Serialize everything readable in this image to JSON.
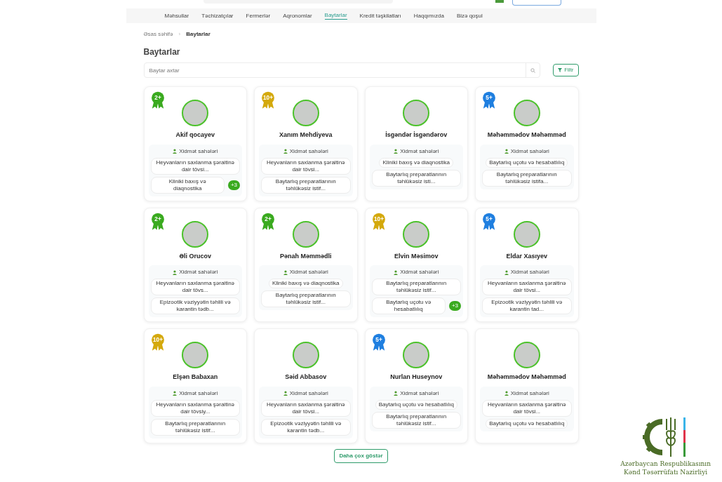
{
  "nav": [
    {
      "label": "Məhsullar",
      "selected": false
    },
    {
      "label": "Təchizatçılar",
      "selected": false
    },
    {
      "label": "Fermerlər",
      "selected": false
    },
    {
      "label": "Aqronomlar",
      "selected": false
    },
    {
      "label": "Baytarlar",
      "selected": true
    },
    {
      "label": "Kredit təşkilatları",
      "selected": false
    },
    {
      "label": "Haqqımızda",
      "selected": false
    },
    {
      "label": "Bizə qoşul",
      "selected": false
    }
  ],
  "breadcrumb": [
    "Əsas səhifə",
    "Baytarlar"
  ],
  "breadcrumb_separator": "›",
  "page_title": "Baytarlar",
  "search": {
    "placeholder": "Baytar axtar"
  },
  "filter_button": "Filtr",
  "vets": [
    {
      "name": "Akif qocayev",
      "badge": {
        "label": "2+",
        "color": "#3aaa1f"
      },
      "services_label": "Xidmət sahələri",
      "services": [
        "Heyvanların saxlanma şəraitinə dair tövsi...",
        "Kliniki baxış və diaqnostika"
      ],
      "more": "+3"
    },
    {
      "name": "Xanım Mehdiyeva",
      "badge": {
        "label": "10+",
        "color": "#d4a90c"
      },
      "services_label": "Xidmət sahələri",
      "services": [
        "Heyvanların saxlanma şəraitinə dair tövsi...",
        "Baytarlıq preparatlarının təhlükəsiz istif..."
      ]
    },
    {
      "name": "İsgəndər İsgəndərov",
      "services_label": "Xidmət sahələri",
      "services": [
        "Kliniki baxış və diaqnostika",
        "Baytarlıq preparatlarının təhlükəsiz isti..."
      ]
    },
    {
      "name": "Məhəmmədov Məhəmməd",
      "badge": {
        "label": "5+",
        "color": "#1f7fe0"
      },
      "services_label": "Xidmət sahələri",
      "services": [
        "Baytarlıq uçotu və hesabatlılıq",
        "Baytarlıq preparatlarının təhlükəsiz istifa..."
      ]
    },
    {
      "name": "Əli Orucov",
      "badge": {
        "label": "2+",
        "color": "#3aaa1f"
      },
      "services_label": "Xidmət sahələri",
      "services": [
        "Heyvanların saxlanma şəraitinə dair tövs...",
        "Epizootik vəziyyətin təhlili və karantin tədb..."
      ]
    },
    {
      "name": "Pənah Məmmədli",
      "badge": {
        "label": "2+",
        "color": "#3aaa1f"
      },
      "services_label": "Xidmət sahələri",
      "services": [
        "Kliniki baxış və diaqnostika",
        "Baytarlıq preparatlarının təhlükəsiz istif..."
      ]
    },
    {
      "name": "Elvin Məsimov",
      "badge": {
        "label": "10+",
        "color": "#d4a90c"
      },
      "services_label": "Xidmət sahələri",
      "services": [
        "Baytarlıq preparatlarının təhlükəsiz istif...",
        "Baytarlıq uçotu və hesabatlılıq"
      ],
      "more": "+3"
    },
    {
      "name": "Eldar Xasıyev",
      "badge": {
        "label": "5+",
        "color": "#1f7fe0"
      },
      "services_label": "Xidmət sahələri",
      "services": [
        "Heyvanların saxlanma şəraitinə dair tövsi...",
        "Epizootik vəziyyətin təhlili və karantin tad..."
      ]
    },
    {
      "name": "Elşən Babaxan",
      "badge": {
        "label": "10+",
        "color": "#d4a90c"
      },
      "services_label": "Xidmət sahələri",
      "services": [
        "Heyvanların saxlanma şəraitinə dair tövsiy...",
        "Baytarlıq preparatlarının təhlükəsiz istif..."
      ]
    },
    {
      "name": "Səid Abbasov",
      "services_label": "Xidmət sahələri",
      "services": [
        "Heyvanların saxlanma şəraitinə dair tövsi...",
        "Epizootik vəziyyətin təhlili və karantin tədb..."
      ]
    },
    {
      "name": "Nurlan Huseynov",
      "badge": {
        "label": "5+",
        "color": "#1f7fe0"
      },
      "services_label": "Xidmət sahələri",
      "services": [
        "Baytarlıq uçotu və hesabatlılıq",
        "Baytarlıq preparatlarının təhlükəsiz istif..."
      ]
    },
    {
      "name": "Məhəmmədov Məhəmməd",
      "services_label": "Xidmət sahələri",
      "services": [
        "Heyvanların saxlanma şəraitinə dair tövsi...",
        "Baytarlıq uçotu və hesabatlılıq"
      ]
    }
  ],
  "more_button": "Daha çox göstər",
  "ministry": {
    "line_1": "Azərbaycan Respublikasının",
    "line_2": "Kənd Təsərrüfatı Nazirliyi"
  }
}
